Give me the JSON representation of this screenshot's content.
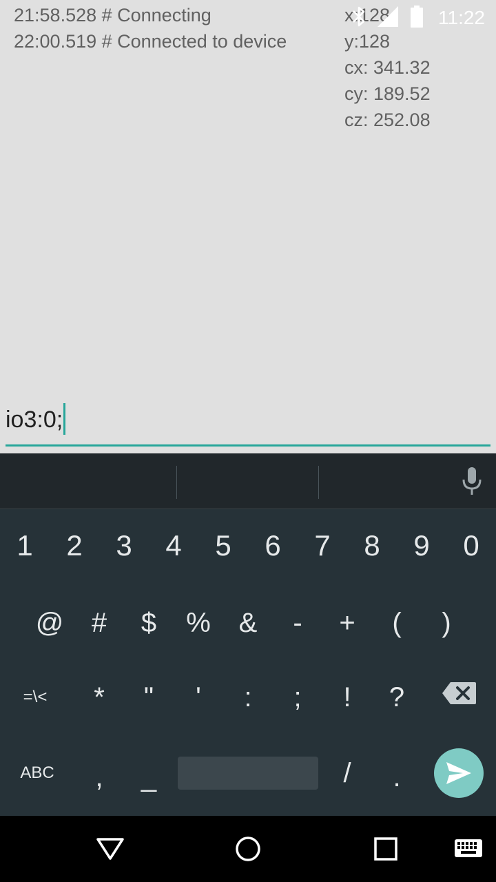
{
  "status_bar": {
    "time": "11:22",
    "icons": [
      "bluetooth-icon",
      "signal-icon",
      "battery-icon"
    ]
  },
  "log": {
    "lines": [
      "21:58.528 # Connecting",
      "22:00.519 # Connected to device"
    ]
  },
  "readout": {
    "x": "x:128",
    "y": "y:128",
    "cx": "cx: 341.32",
    "cy": "cy: 189.52",
    "cz": "cz: 252.08"
  },
  "command_input": {
    "value": "io3:0;"
  },
  "keyboard": {
    "row_numbers": [
      "1",
      "2",
      "3",
      "4",
      "5",
      "6",
      "7",
      "8",
      "9",
      "0"
    ],
    "row_symbols_1": [
      "@",
      "#",
      "$",
      "%",
      "&",
      "-",
      "+",
      "(",
      ")"
    ],
    "row_symbols_2": [
      "=\\<",
      "*",
      "\"",
      "'",
      ":",
      ";",
      "!",
      "?"
    ],
    "row_bottom": {
      "abc": "ABC",
      "comma": ",",
      "underscore": "_",
      "slash": "/",
      "period": "."
    }
  },
  "colors": {
    "accent": "#26a69a",
    "keyboard_bg": "#263238",
    "enter_key": "#7fcbc4"
  }
}
